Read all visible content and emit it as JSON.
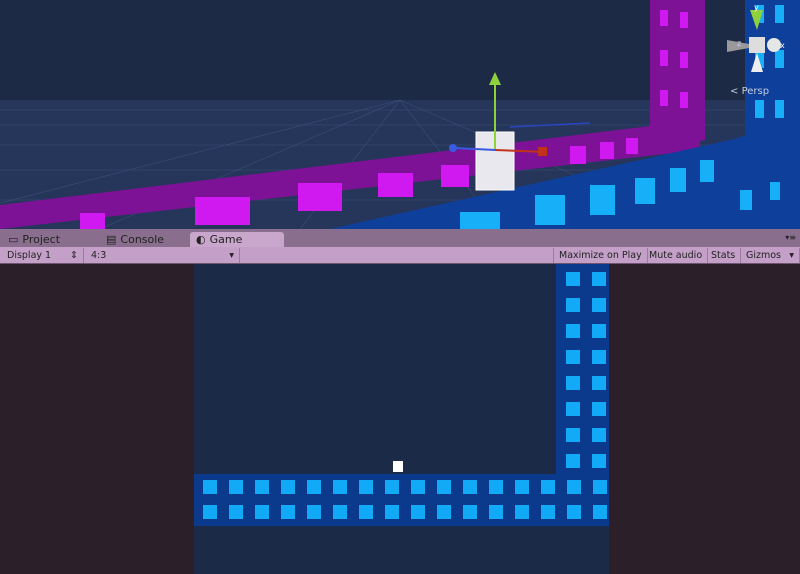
{
  "scene_view": {
    "projection_label": "Persp",
    "gizmo_axes": {
      "y": "y",
      "x": "x",
      "z": "z"
    }
  },
  "tabs": [
    {
      "label": "Project",
      "icon": "folder-icon",
      "active": false
    },
    {
      "label": "Console",
      "icon": "console-icon",
      "active": false
    },
    {
      "label": "Game",
      "icon": "game-icon",
      "active": true
    }
  ],
  "toolbar": {
    "display": "Display 1",
    "aspect": "4:3",
    "maximize_on_play": "Maximize on Play",
    "mute_audio": "Mute audio",
    "stats": "Stats",
    "gizmos": "Gizmos"
  },
  "colors": {
    "tile": "#12aaf7",
    "band": "#0b3a8c",
    "background": "#1b2a47",
    "magenta": "#b20fd6"
  }
}
